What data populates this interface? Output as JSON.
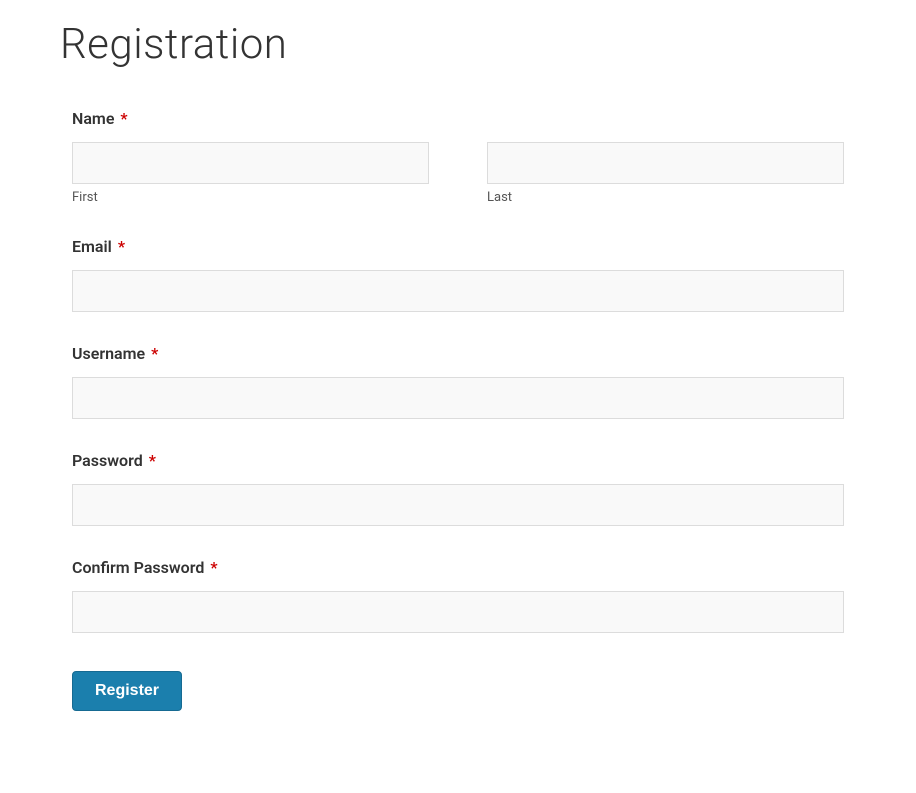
{
  "page": {
    "title": "Registration"
  },
  "form": {
    "name": {
      "label": "Name",
      "required_mark": "*",
      "first_sub": "First",
      "last_sub": "Last",
      "first_value": "",
      "last_value": ""
    },
    "email": {
      "label": "Email",
      "required_mark": "*",
      "value": ""
    },
    "username": {
      "label": "Username",
      "required_mark": "*",
      "value": ""
    },
    "password": {
      "label": "Password",
      "required_mark": "*",
      "value": ""
    },
    "confirm_password": {
      "label": "Confirm Password",
      "required_mark": "*",
      "value": ""
    },
    "submit_label": "Register"
  }
}
